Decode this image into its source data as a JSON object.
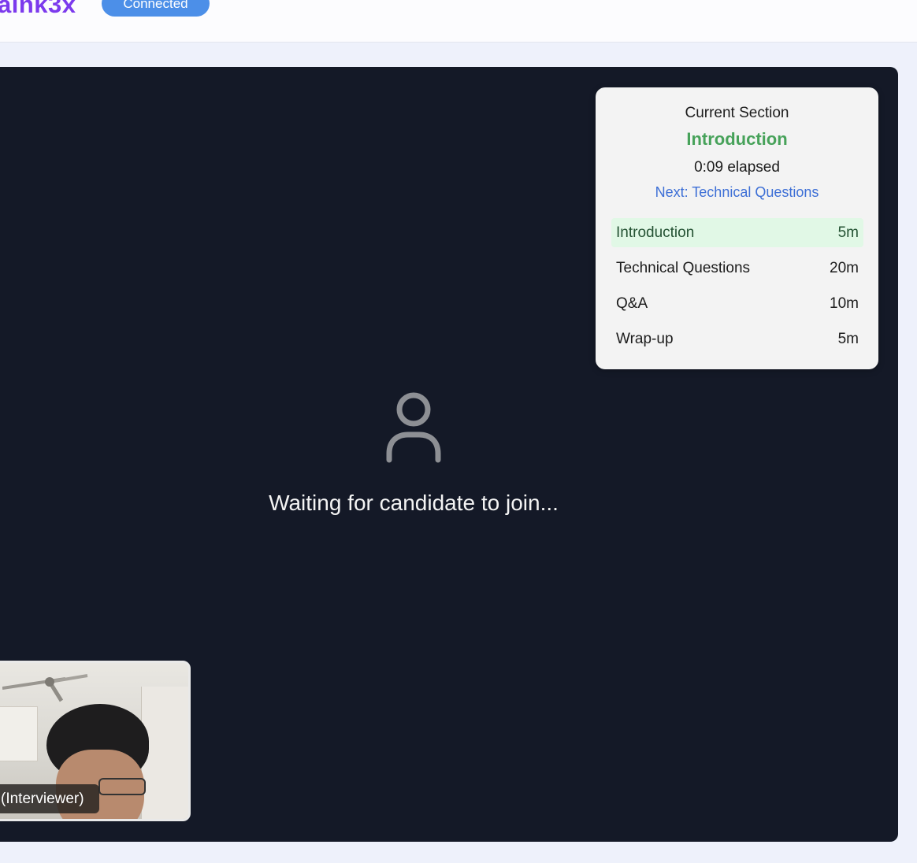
{
  "header": {
    "brand": "aink3x",
    "status": "Connected"
  },
  "agenda": {
    "heading": "Current Section",
    "current_section": "Introduction",
    "elapsed": "0:09 elapsed",
    "next": "Next: Technical Questions",
    "items": [
      {
        "name": "Introduction",
        "duration": "5m",
        "active": true
      },
      {
        "name": "Technical Questions",
        "duration": "20m",
        "active": false
      },
      {
        "name": "Q&A",
        "duration": "10m",
        "active": false
      },
      {
        "name": "Wrap-up",
        "duration": "5m",
        "active": false
      }
    ]
  },
  "stage": {
    "placeholder_icon": "person-icon",
    "waiting_message": "Waiting for candidate to join..."
  },
  "self_view": {
    "label": "(Interviewer)"
  },
  "colors": {
    "brand": "#7c3aed",
    "status_badge": "#4c8fe8",
    "stage_background": "#141927",
    "active_section": "#47a25a",
    "next_link": "#3d6fd6",
    "active_row_background": "#e1f8e6"
  }
}
